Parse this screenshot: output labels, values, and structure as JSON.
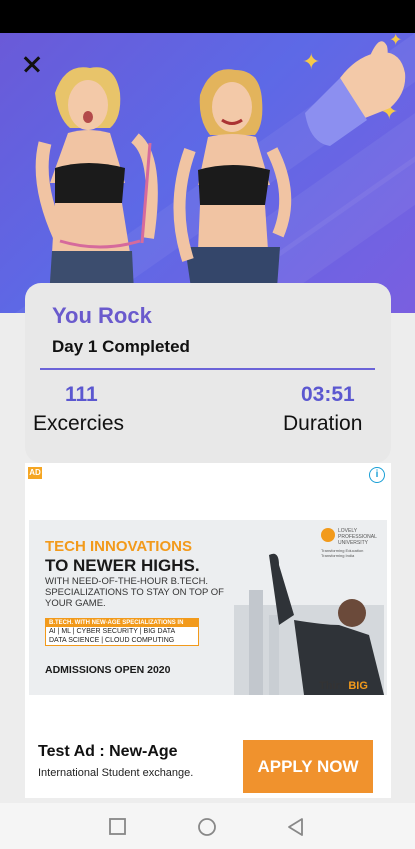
{
  "result_card": {
    "title": "You Rock",
    "subtitle": "Day 1 Completed",
    "stats": [
      {
        "value": "111",
        "label": "Excercies"
      },
      {
        "value": "03:51",
        "label": "Duration"
      }
    ]
  },
  "ad": {
    "badge": "AD",
    "banner": {
      "headline1": "TECH INNOVATIONS",
      "headline2": "TO NEWER HIGHS.",
      "body": "WITH NEED-OF-THE-HOUR B.TECH. SPECIALIZATIONS TO STAY ON TOP OF YOUR GAME.",
      "box_header": "B.TECH. WITH NEW-AGE SPECIALIZATIONS IN",
      "box_lines": [
        "AI | ML | CYBER SECURITY | BIG DATA",
        "DATA SCIENCE | CLOUD COMPUTING"
      ],
      "admissions": "ADMISSIONS OPEN 2020",
      "logo_text": "LOVELY PROFESSIONAL UNIVERSITY",
      "logo_tagline": "Transforming Education Transforming India",
      "brand_a": "Think",
      "brand_b": "BIG"
    },
    "title": "Test Ad : New-Age",
    "description": "International Student exchange.",
    "cta": "APPLY NOW"
  },
  "colors": {
    "accent": "#6a5acd",
    "hero": "#5d69e6",
    "cta": "#f0922d"
  },
  "icons": [
    "close-icon",
    "sparkle-icon",
    "thumbs-up-icon",
    "info-icon",
    "nav-recent-icon",
    "nav-home-icon",
    "nav-back-icon"
  ]
}
